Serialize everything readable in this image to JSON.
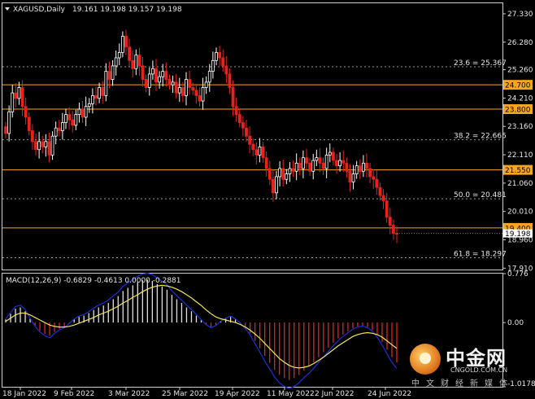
{
  "header": {
    "symbol": "XAGUSD,Daily",
    "ohlc": "19.161 19.198 19.157 19.198"
  },
  "macd_label": "MACD(12,26,9) -0.6829 -0.4613 0.0000 -0.2881",
  "watermark": {
    "title": "中金网",
    "url": "CNGOLD.COM.CN",
    "subtitle": "中文财经新媒体"
  },
  "colors": {
    "background": "#000000",
    "bull_candle": "#ffffff",
    "bear_candle": "#e8221b",
    "hline": "#f5a623",
    "fib": "#9a9a9a",
    "signal": "#f5e55a",
    "macd_line": "#1e2fd6",
    "current_price_bg": "#ffffff"
  },
  "chart_data": [
    {
      "type": "candlestick",
      "title": "XAGUSD,Daily",
      "ylim": [
        17.86,
        27.72
      ],
      "y_ticks": [
        "27.330",
        "26.280",
        "25.260",
        "24.210",
        "23.160",
        "22.110",
        "21.060",
        "20.010",
        "18.960",
        "17.910"
      ],
      "x_ticks": [
        "18 Jan 2022",
        "9 Feb 2022",
        "3 Mar 2022",
        "25 Mar 2022",
        "19 Apr 2022",
        "11 May 2022",
        "2 Jun 2022",
        "24 Jun 2022"
      ],
      "horizontal_levels": [
        {
          "label": "24.700",
          "value": 24.7
        },
        {
          "label": "23.800",
          "value": 23.8
        },
        {
          "label": "21.550",
          "value": 21.55
        },
        {
          "label": "19.400",
          "value": 19.4
        }
      ],
      "fib_levels": [
        {
          "label": "23.6 = 25.367",
          "value": 25.367
        },
        {
          "label": "38.2 = 22.665",
          "value": 22.665
        },
        {
          "label": "50.0 = 20.481",
          "value": 20.481
        },
        {
          "label": "61.8 = 18.297",
          "value": 18.297
        }
      ],
      "current_price": "19.198",
      "closes": [
        22.9,
        23.7,
        24.4,
        24.2,
        24.6,
        23.9,
        23.5,
        23.0,
        22.6,
        22.3,
        22.6,
        22.4,
        22.6,
        22.1,
        22.8,
        23.1,
        23.0,
        23.3,
        23.6,
        23.4,
        23.2,
        23.6,
        23.8,
        23.5,
        23.9,
        24.0,
        24.3,
        24.2,
        24.6,
        24.3,
        25.2,
        24.9,
        25.4,
        25.7,
        25.9,
        26.5,
        26.1,
        25.6,
        25.3,
        25.8,
        25.4,
        24.9,
        24.6,
        25.1,
        25.3,
        24.8,
        25.0,
        25.2,
        24.9,
        24.7,
        24.8,
        24.4,
        24.6,
        24.3,
        24.9,
        24.6,
        24.5,
        24.3,
        24.1,
        24.6,
        24.8,
        25.2,
        25.6,
        25.9,
        25.7,
        25.4,
        25.1,
        24.6,
        23.9,
        23.6,
        23.3,
        23.1,
        22.8,
        22.5,
        22.3,
        22.1,
        22.4,
        22.0,
        21.6,
        21.2,
        20.7,
        21.3,
        21.6,
        21.2,
        21.4,
        21.6,
        21.5,
        21.8,
        21.6,
        22.0,
        21.8,
        21.5,
        21.9,
        22.0,
        21.8,
        21.6,
        22.1,
        22.2,
        21.9,
        21.7,
        21.9,
        21.8,
        21.5,
        21.1,
        21.4,
        21.7,
        21.5,
        21.8,
        21.6,
        21.3,
        21.2,
        20.9,
        20.6,
        20.4,
        19.8,
        19.5,
        19.2,
        19.198
      ]
    },
    {
      "type": "macd",
      "title": "MACD(12,26,9)",
      "ylim": [
        -1.0178,
        0.776
      ],
      "y_ticks": [
        "0.776",
        "0.00",
        "-1.0178"
      ],
      "values": [
        0.05,
        0.14,
        0.22,
        0.24,
        0.18,
        0.06,
        -0.05,
        -0.13,
        -0.18,
        -0.21,
        -0.15,
        -0.1,
        -0.07,
        -0.01,
        0.05,
        0.09,
        0.11,
        0.15,
        0.2,
        0.24,
        0.27,
        0.31,
        0.37,
        0.42,
        0.5,
        0.55,
        0.59,
        0.64,
        0.67,
        0.68,
        0.66,
        0.61,
        0.57,
        0.52,
        0.44,
        0.37,
        0.31,
        0.24,
        0.18,
        0.11,
        0.04,
        -0.03,
        -0.07,
        -0.04,
        0.02,
        0.06,
        0.09,
        0.05,
        -0.01,
        -0.08,
        -0.17,
        -0.29,
        -0.41,
        -0.53,
        -0.64,
        -0.75,
        -0.83,
        -0.88,
        -0.91,
        -0.88,
        -0.83,
        -0.76,
        -0.7,
        -0.63,
        -0.55,
        -0.47,
        -0.4,
        -0.32,
        -0.25,
        -0.19,
        -0.14,
        -0.09,
        -0.06,
        -0.05,
        -0.07,
        -0.12,
        -0.2,
        -0.31,
        -0.43,
        -0.55,
        -0.63
      ],
      "signal": [
        0.02,
        0.07,
        0.12,
        0.15,
        0.15,
        0.12,
        0.08,
        0.04,
        0.0,
        -0.04,
        -0.06,
        -0.07,
        -0.07,
        -0.06,
        -0.04,
        -0.01,
        0.02,
        0.05,
        0.08,
        0.12,
        0.15,
        0.18,
        0.22,
        0.26,
        0.31,
        0.35,
        0.4,
        0.44,
        0.49,
        0.53,
        0.56,
        0.58,
        0.59,
        0.58,
        0.56,
        0.53,
        0.49,
        0.44,
        0.39,
        0.33,
        0.27,
        0.2,
        0.14,
        0.09,
        0.06,
        0.04,
        0.02,
        0.0,
        -0.03,
        -0.07,
        -0.12,
        -0.18,
        -0.25,
        -0.33,
        -0.41,
        -0.49,
        -0.57,
        -0.63,
        -0.68,
        -0.71,
        -0.72,
        -0.71,
        -0.69,
        -0.65,
        -0.6,
        -0.55,
        -0.49,
        -0.43,
        -0.37,
        -0.32,
        -0.27,
        -0.22,
        -0.19,
        -0.17,
        -0.16,
        -0.17,
        -0.19,
        -0.23,
        -0.29,
        -0.35,
        -0.41
      ]
    }
  ]
}
